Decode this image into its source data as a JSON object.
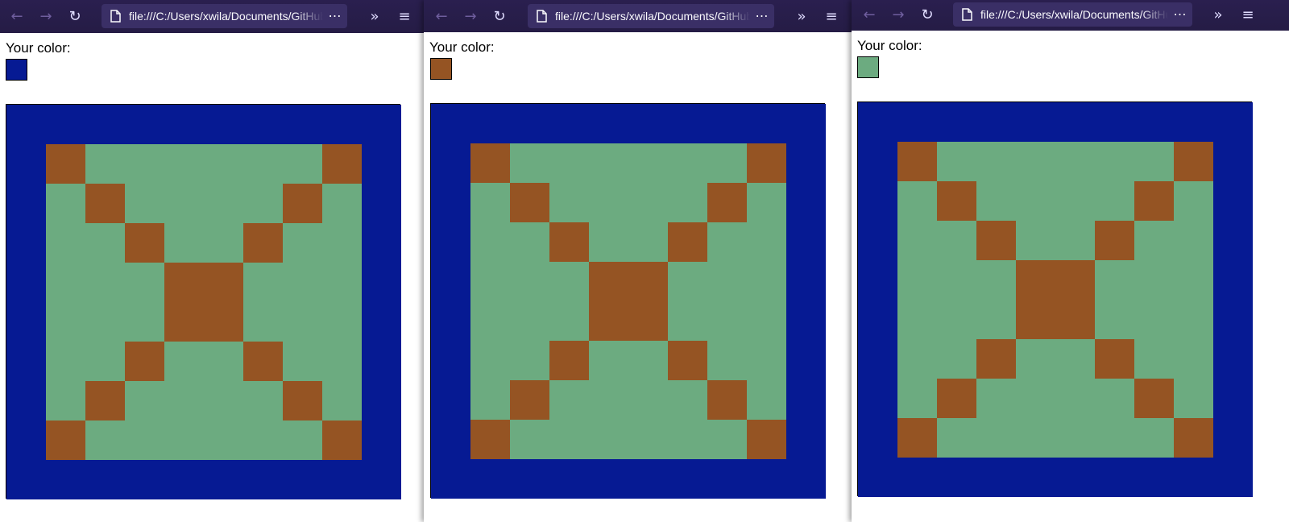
{
  "colors": {
    "blue": "#061a93",
    "brown": "#955423",
    "green": "#6cab80",
    "toolbar_bg": "#251c45"
  },
  "windows": [
    {
      "url": "file:///C:/Users/xwila/Documents/GitHub",
      "label": "Your color:",
      "swatch_color": "#061a93"
    },
    {
      "url": "file:///C:/Users/xwila/Documents/GitHub",
      "label": "Your color:",
      "swatch_color": "#955423"
    },
    {
      "url": "file:///C:/Users/xwila/Documents/GitHub",
      "label": "Your color:",
      "swatch_color": "#6cab80"
    }
  ],
  "icons": {
    "back": "back-arrow-icon",
    "forward": "forward-arrow-icon",
    "reload": "reload-icon",
    "page": "page-icon",
    "more": "more-icon",
    "overflow": "overflow-chevrons-icon",
    "menu": "hamburger-menu-icon"
  },
  "board": {
    "rows": 10,
    "cols": 10,
    "grid": [
      "BBBBBBBBBB",
      "BOGGGGGGOB",
      "BGOGGGGOGB",
      "BGGOGGOGGB",
      "BGGGOOGGGB",
      "BGGGOOGGGB",
      "BGGOGGOGGB",
      "BGOGGGGOGB",
      "BOGGGGGGOB",
      "BBBBBBBBBB"
    ]
  }
}
